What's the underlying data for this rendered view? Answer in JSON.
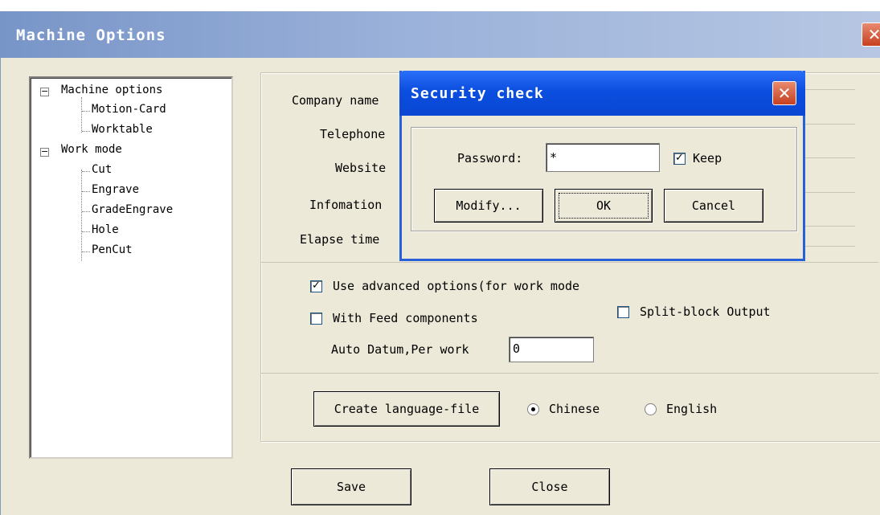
{
  "window": {
    "title": "Machine Options"
  },
  "tree": {
    "items": [
      {
        "label": "Machine options",
        "level": 0,
        "expander": "−"
      },
      {
        "label": "Motion-Card",
        "level": 1
      },
      {
        "label": "Worktable",
        "level": 1
      },
      {
        "label": "Work mode",
        "level": 0,
        "expander": "−"
      },
      {
        "label": "Cut",
        "level": 1
      },
      {
        "label": "Engrave",
        "level": 1
      },
      {
        "label": "GradeEngrave",
        "level": 1
      },
      {
        "label": "Hole",
        "level": 1
      },
      {
        "label": "PenCut",
        "level": 1
      }
    ]
  },
  "info": {
    "company_label": "Company name",
    "telephone_label": "Telephone",
    "website_label": "Website",
    "information_label": "Infomation",
    "elapse_label": "Elapse time"
  },
  "options": {
    "advanced_label": "Use advanced options(for work mode",
    "advanced_checked": true,
    "feed_label": "With Feed components",
    "feed_checked": false,
    "split_label": "Split-block Output",
    "split_checked": false,
    "datum_label": "Auto Datum,Per work",
    "datum_value": "0"
  },
  "language": {
    "create_button": "Create language-file",
    "chinese_label": "Chinese",
    "english_label": "English",
    "selected": "Chinese"
  },
  "footer": {
    "save_label": "Save",
    "close_label": "Close"
  },
  "security_dialog": {
    "title": "Security check",
    "password_label": "Password:",
    "password_value": "*",
    "keep_label": "Keep",
    "keep_checked": true,
    "modify_label": "Modify...",
    "ok_label": "OK",
    "cancel_label": "Cancel"
  },
  "icons": {
    "close": "close-icon",
    "check": "check-icon",
    "tree_collapse": "minus-icon"
  },
  "colors": {
    "dialog_titlebar": "#0a47d2",
    "close_button": "#c6401f",
    "window_bg": "#ece9d8"
  }
}
